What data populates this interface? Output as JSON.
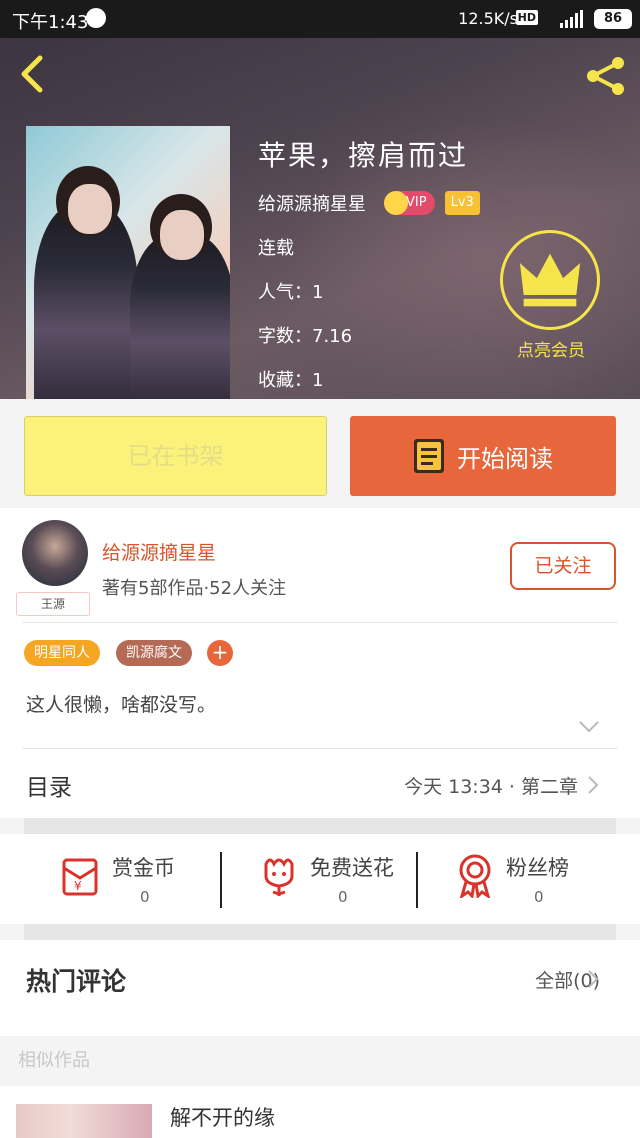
{
  "status_bar": {
    "time": "下午1:43",
    "network_speed": "12.5K/s",
    "hd": "HD",
    "battery": "86"
  },
  "book": {
    "title": "苹果，擦肩而过",
    "author": "给源源摘星星",
    "vip_label": "VIP",
    "level": "Lv3",
    "status": "连载",
    "popularity": "人气：1",
    "word_count": "字数：7.16",
    "favorites": "收藏：1",
    "vip_badge_label": "点亮会员"
  },
  "actions": {
    "shelf_label": "已在书架",
    "read_label": "开始阅读"
  },
  "author_card": {
    "avatar_tag": "王源",
    "name": "给源源摘星星",
    "stats": "著有5部作品·52人关注",
    "follow_label": "已关注",
    "tags": [
      "明星同人",
      "凯源腐文"
    ],
    "add_tag": "+",
    "bio": "这人很懒，啥都没写。"
  },
  "toc": {
    "label": "目录",
    "latest": "今天 13:34 · 第二章"
  },
  "rewards": [
    {
      "label": "赏金币",
      "count": "0",
      "icon": "red-envelope-icon"
    },
    {
      "label": "免费送花",
      "count": "0",
      "icon": "flower-icon"
    },
    {
      "label": "粉丝榜",
      "count": "0",
      "icon": "medal-icon"
    }
  ],
  "comments": {
    "label": "热门评论",
    "all_label": "全部(0)"
  },
  "similar": {
    "label": "相似作品",
    "first_title": "解不开的缘"
  },
  "colors": {
    "accent_orange": "#e8663b",
    "shelf_yellow": "#fbf27b",
    "vip_gold": "#f5e44a",
    "author_red": "#d9532c"
  }
}
